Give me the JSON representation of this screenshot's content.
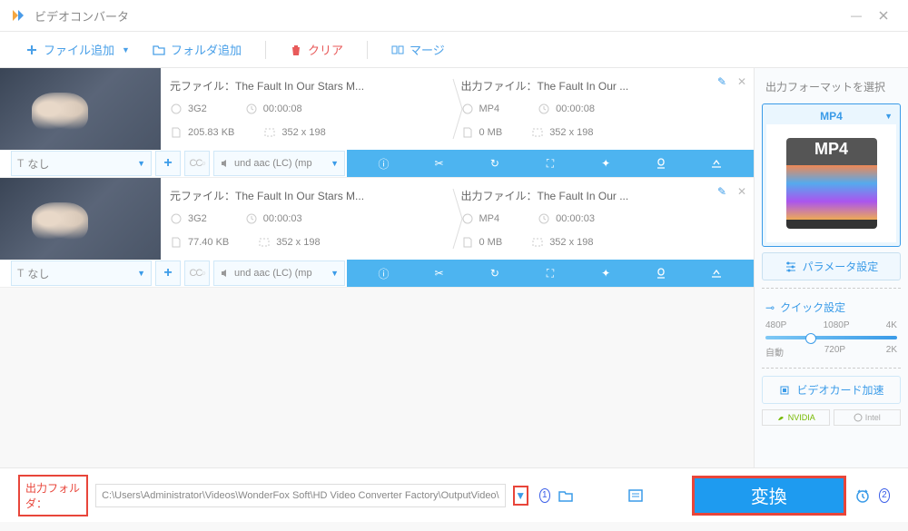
{
  "window": {
    "title": "ビデオコンバータ"
  },
  "toolbar": {
    "add_file": "ファイル追加",
    "add_folder": "フォルダ追加",
    "clear": "クリア",
    "merge": "マージ"
  },
  "items": [
    {
      "src_label": "元ファイル：",
      "src_name": "The Fault In Our Stars M...",
      "out_label": "出力ファイル：",
      "out_name": "The Fault In Our ...",
      "src_fmt": "3G2",
      "out_fmt": "MP4",
      "src_dur": "00:00:08",
      "out_dur": "00:00:08",
      "src_size": "205.83 KB",
      "out_size": "0 MB",
      "src_res": "352 x 198",
      "out_res": "352 x 198",
      "subtitle": "なし",
      "audio": "und aac (LC) (mp"
    },
    {
      "src_label": "元ファイル：",
      "src_name": "The Fault In Our Stars M...",
      "out_label": "出力ファイル：",
      "out_name": "The Fault In Our ...",
      "src_fmt": "3G2",
      "out_fmt": "MP4",
      "src_dur": "00:00:03",
      "out_dur": "00:00:03",
      "src_size": "77.40 KB",
      "out_size": "0 MB",
      "src_res": "352 x 198",
      "out_res": "352 x 198",
      "subtitle": "なし",
      "audio": "und aac (LC) (mp"
    }
  ],
  "side": {
    "head": "出力フォーマットを選択",
    "format": "MP4",
    "param": "パラメータ設定",
    "quick": "クイック設定",
    "res": {
      "p480": "480P",
      "p1080": "1080P",
      "p4k": "4K",
      "auto": "自動",
      "p720": "720P",
      "p2k": "2K"
    },
    "gpu": "ビデオカード加速",
    "nvidia": "NVIDIA",
    "intel": "Intel"
  },
  "bottom": {
    "label": "出力フォルダ：",
    "path": "C:\\Users\\Administrator\\Videos\\WonderFox Soft\\HD Video Converter Factory\\OutputVideo\\",
    "convert": "変換",
    "num1": "1",
    "num2": "2"
  }
}
